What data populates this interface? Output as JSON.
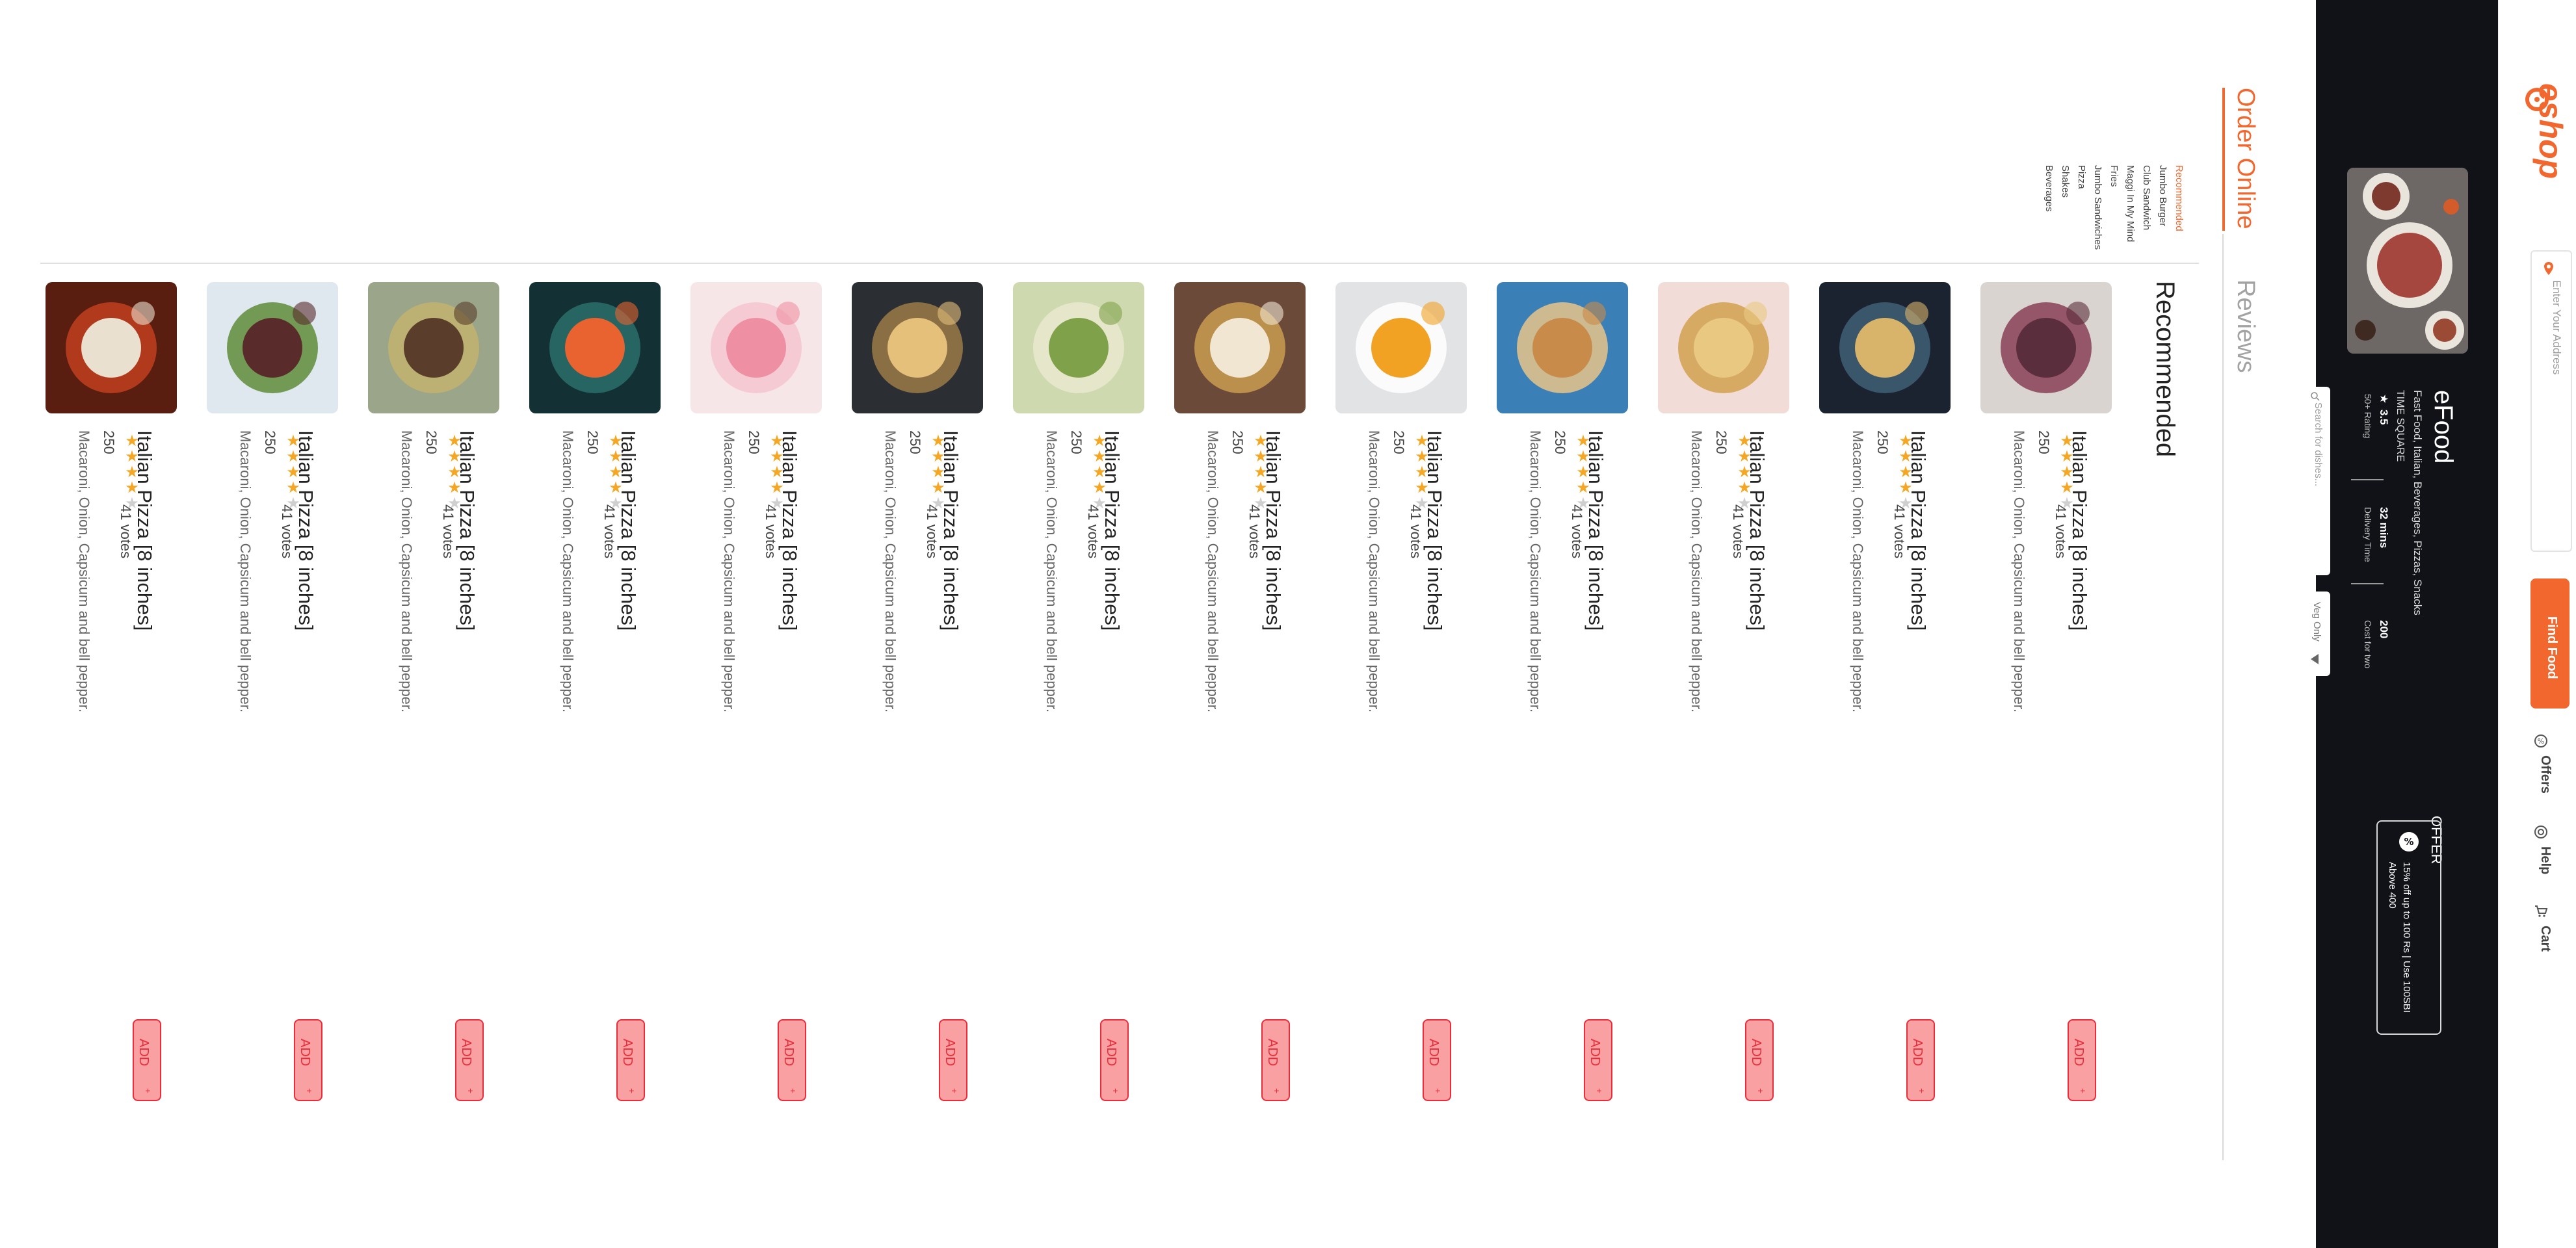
{
  "brand": {
    "name": "eshop"
  },
  "search": {
    "address_placeholder": "Enter Your Address",
    "find_label": "Find Food"
  },
  "nav": {
    "offers": "Offers",
    "help": "Help",
    "cart": "Cart"
  },
  "restaurant": {
    "name": "eFood",
    "cuisines": "Fast Food, Italian, Beverages, Pizzas, Snacks",
    "location": "TIME SQUARE",
    "rating_value": "3.5",
    "rating_label": "50+ Rating",
    "delivery_value": "32 mins",
    "delivery_label": "Delivery Time",
    "cost_value": "200",
    "cost_label": "Cost for two",
    "search_placeholder": "Search for dishes...",
    "veg_only": "Veg Only"
  },
  "offer": {
    "title": "OFFER",
    "text": "15% off up to 100 Rs | Use 100SBI Above 400"
  },
  "tabs": {
    "order_online": "Order Online",
    "reviews": "Reviews"
  },
  "categories": [
    {
      "label": "Recommended",
      "active": true
    },
    {
      "label": "Jumbo Burger",
      "active": false
    },
    {
      "label": "Club Sandwich",
      "active": false
    },
    {
      "label": "Maggi In My Mind",
      "active": false
    },
    {
      "label": "Fries",
      "active": false
    },
    {
      "label": "Jumbo Sandwiches",
      "active": false
    },
    {
      "label": "Pizza",
      "active": false
    },
    {
      "label": "Shakes",
      "active": false
    },
    {
      "label": "Beverages",
      "active": false
    }
  ],
  "section_title": "Recommended",
  "colors": {
    "accent": "#f2672d",
    "dark": "#111218",
    "add_bg": "#f8a0a2",
    "add_border": "#ee2b38",
    "star": "#f5a623"
  },
  "dishes": [
    {
      "name": "Italian Pizza [8 inches]",
      "rating": 4,
      "votes": "41 votes",
      "price": "250",
      "description": "Macaroni, Onion, Capsicum and bell pepper.",
      "add_label": "ADD",
      "add_plus": "+"
    },
    {
      "name": "Italian Pizza [8 inches]",
      "rating": 4,
      "votes": "41 votes",
      "price": "250",
      "description": "Macaroni, Onion, Capsicum and bell pepper.",
      "add_label": "ADD",
      "add_plus": "+"
    },
    {
      "name": "Italian Pizza [8 inches]",
      "rating": 4,
      "votes": "41 votes",
      "price": "250",
      "description": "Macaroni, Onion, Capsicum and bell pepper.",
      "add_label": "ADD",
      "add_plus": "+"
    },
    {
      "name": "Italian Pizza [8 inches]",
      "rating": 4,
      "votes": "41 votes",
      "price": "250",
      "description": "Macaroni, Onion, Capsicum and bell pepper.",
      "add_label": "ADD",
      "add_plus": "+"
    },
    {
      "name": "Italian Pizza [8 inches]",
      "rating": 4,
      "votes": "41 votes",
      "price": "250",
      "description": "Macaroni, Onion, Capsicum and bell pepper.",
      "add_label": "ADD",
      "add_plus": "+"
    },
    {
      "name": "Italian Pizza [8 inches]",
      "rating": 4,
      "votes": "41 votes",
      "price": "250",
      "description": "Macaroni, Onion, Capsicum and bell pepper.",
      "add_label": "ADD",
      "add_plus": "+"
    },
    {
      "name": "Italian Pizza [8 inches]",
      "rating": 4,
      "votes": "41 votes",
      "price": "250",
      "description": "Macaroni, Onion, Capsicum and bell pepper.",
      "add_label": "ADD",
      "add_plus": "+"
    },
    {
      "name": "Italian Pizza [8 inches]",
      "rating": 4,
      "votes": "41 votes",
      "price": "250",
      "description": "Macaroni, Onion, Capsicum and bell pepper.",
      "add_label": "ADD",
      "add_plus": "+"
    },
    {
      "name": "Italian Pizza [8 inches]",
      "rating": 4,
      "votes": "41 votes",
      "price": "250",
      "description": "Macaroni, Onion, Capsicum and bell pepper.",
      "add_label": "ADD",
      "add_plus": "+"
    },
    {
      "name": "Italian Pizza [8 inches]",
      "rating": 4,
      "votes": "41 votes",
      "price": "250",
      "description": "Macaroni, Onion, Capsicum and bell pepper.",
      "add_label": "ADD",
      "add_plus": "+"
    },
    {
      "name": "Italian Pizza [8 inches]",
      "rating": 4,
      "votes": "41 votes",
      "price": "250",
      "description": "Macaroni, Onion, Capsicum and bell pepper.",
      "add_label": "ADD",
      "add_plus": "+"
    },
    {
      "name": "Italian Pizza [8 inches]",
      "rating": 4,
      "votes": "41 votes",
      "price": "250",
      "description": "Macaroni, Onion, Capsicum and bell pepper.",
      "add_label": "ADD",
      "add_plus": "+"
    },
    {
      "name": "Italian Pizza [8 inches]",
      "rating": 4,
      "votes": "41 votes",
      "price": "250",
      "description": "Macaroni, Onion, Capsicum and bell pepper.",
      "add_label": "ADD",
      "add_plus": "+"
    }
  ]
}
